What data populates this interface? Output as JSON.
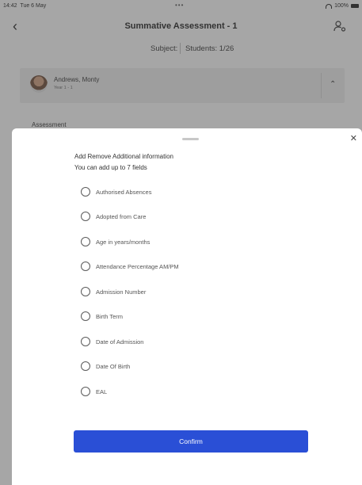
{
  "status_bar": {
    "time": "14:42",
    "date": "Tue 6 May",
    "battery": "100%"
  },
  "nav": {
    "title": "Summative Assessment - 1"
  },
  "subbar": {
    "subject": "Subject:",
    "students": "Students: 1/26"
  },
  "student": {
    "name": "Andrews, Monty",
    "year": "Year 1 - 1"
  },
  "assessment_label": "Assessment",
  "sheet": {
    "heading": "Add Remove Additional information",
    "subheading": "You can add up to 7 fields",
    "options": [
      {
        "label": "Authorised Absences",
        "checked": false
      },
      {
        "label": "Adopted from Care",
        "checked": false
      },
      {
        "label": "Age in years/months",
        "checked": false
      },
      {
        "label": "Attendance Percentage AM/PM",
        "checked": false
      },
      {
        "label": "Admission Number",
        "checked": false
      },
      {
        "label": "Birth Term",
        "checked": false
      },
      {
        "label": "Date of Admission",
        "checked": false
      },
      {
        "label": "Date Of Birth",
        "checked": false
      },
      {
        "label": "EAL",
        "checked": false
      }
    ],
    "confirm_label": "Confirm"
  },
  "colors": {
    "accent": "#2a4fd6"
  },
  "icons": {
    "back": "chevron-left-icon",
    "user_settings": "user-settings-icon",
    "collapse": "chevron-up-icon",
    "close": "close-icon"
  }
}
